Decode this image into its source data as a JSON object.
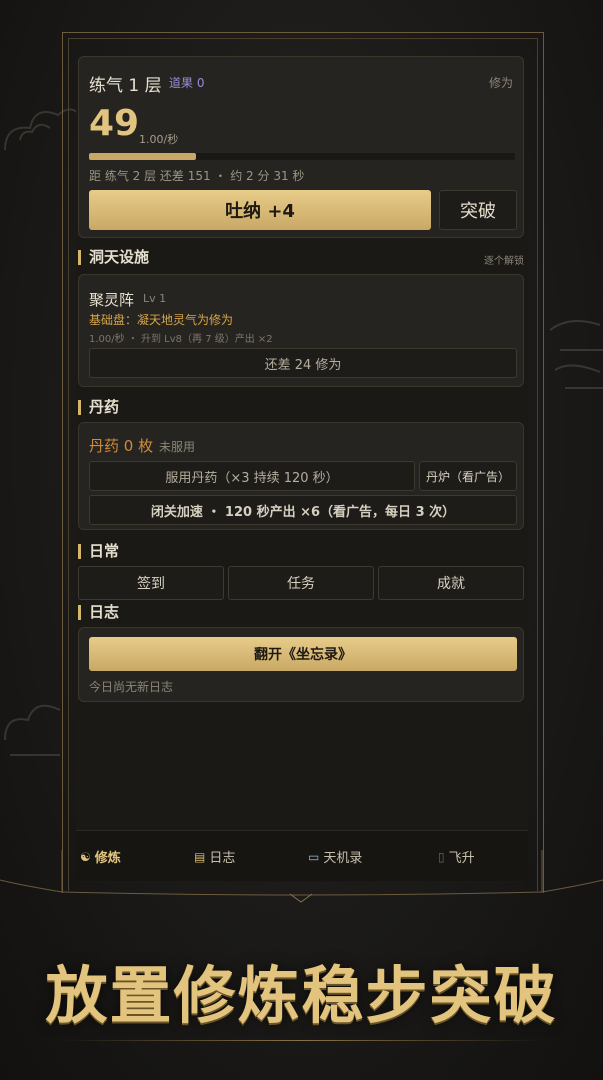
{
  "cultivation": {
    "realm": "练气 1 层",
    "dao_badge": "道果 0",
    "right_label": "修为",
    "value": "49",
    "rate": "1.00/秒",
    "progress": 0.25,
    "next_text": "距 练气 2 层 还差 151 ・ 约 2 分 31 秒",
    "breathe_label": "吐纳 +4",
    "breakthrough_label": "突破"
  },
  "facilities": {
    "title": "洞天设施",
    "action": "逐个解锁",
    "name": "聚灵阵",
    "level": "Lv 1",
    "desc": "基础盘：凝天地灵气为修为",
    "detail": "1.00/秒 ・ 升到 Lv8（再 7 级）产出 ×2",
    "need_label": "还差 24 修为"
  },
  "pills": {
    "title": "丹药",
    "count": "丹药 0 枚",
    "status": "未服用",
    "take_label": "服用丹药（×3 持续 120 秒）",
    "furnace_label": "丹炉（看广告）",
    "retreat_label": "闭关加速 ・ 120 秒产出 ×6（看广告，每日 3 次）"
  },
  "daily": {
    "title": "日常",
    "checkin": "签到",
    "tasks": "任务",
    "achievements": "成就"
  },
  "log": {
    "title": "日志",
    "open_label": "翻开《坐忘录》",
    "empty": "今日尚无新日志"
  },
  "nav": {
    "cultivate": "修炼",
    "log": "日志",
    "tianji": "天机录",
    "ascend": "飞升"
  },
  "headline": "放置修炼稳步突破",
  "colors": {
    "gold": "#d6b66d",
    "purple": "#9b8ad8",
    "orange": "#d08a3a"
  }
}
